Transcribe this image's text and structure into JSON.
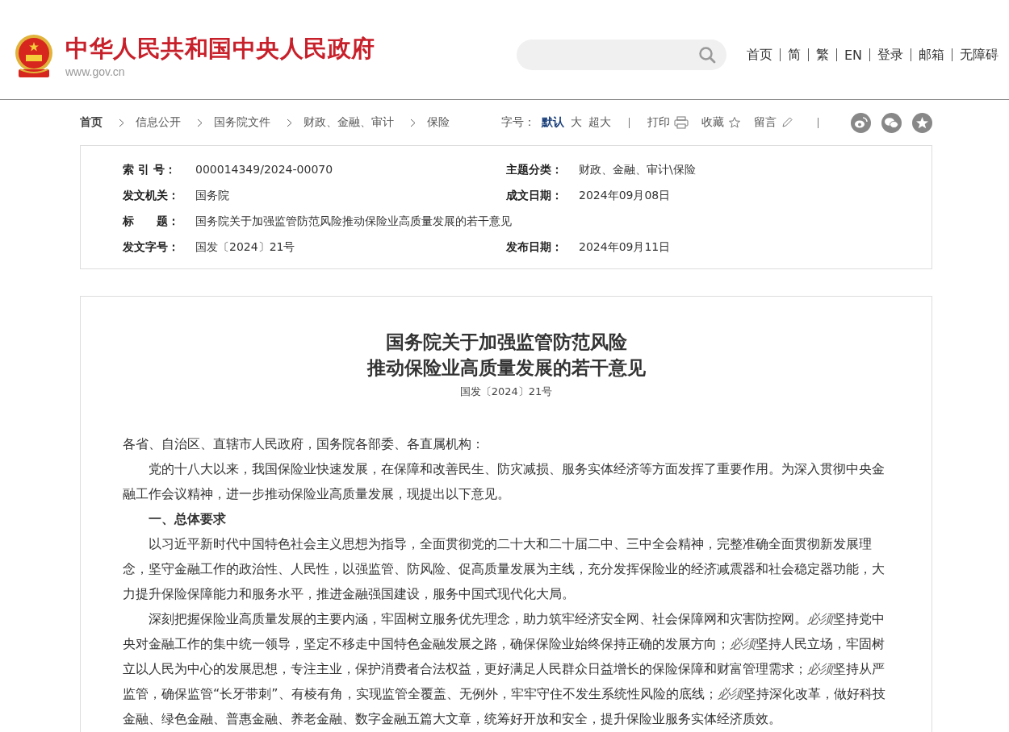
{
  "header": {
    "site_name": "中华人民共和国中央人民政府",
    "site_url": "www.gov.cn",
    "nav": [
      "首页",
      "简",
      "繁",
      "EN",
      "登录",
      "邮箱",
      "无障碍"
    ]
  },
  "breadcrumb": [
    "首页",
    "信息公开",
    "国务院文件",
    "财政、金融、审计",
    "保险"
  ],
  "toolbar": {
    "font_label": "字号：",
    "font_options": [
      {
        "label": "默认",
        "selected": true
      },
      {
        "label": "大",
        "selected": false
      },
      {
        "label": "超大",
        "selected": false
      }
    ],
    "actions": [
      {
        "label": "打印",
        "kind": "print"
      },
      {
        "label": "收藏",
        "kind": "favorite"
      },
      {
        "label": "留言",
        "kind": "comment"
      }
    ],
    "share": [
      {
        "kind": "weibo"
      },
      {
        "kind": "wechat"
      },
      {
        "kind": "star"
      }
    ]
  },
  "info": [
    [
      {
        "label": "索 引 号：",
        "value": "000014349/2024-00070"
      },
      {
        "label": "主题分类：",
        "value": "财政、金融、审计\\保险"
      }
    ],
    [
      {
        "label": "发文机关：",
        "value": "国务院"
      },
      {
        "label": "成文日期：",
        "value": "2024年09月08日"
      }
    ],
    [
      {
        "label": "标　　题：",
        "value": "国务院关于加强监管防范风险推动保险业高质量发展的若干意见"
      }
    ],
    [
      {
        "label": "发文字号：",
        "value": "国发〔2024〕21号"
      },
      {
        "label": "发布日期：",
        "value": "2024年09月11日"
      }
    ]
  ],
  "article": {
    "title_lines": [
      "国务院关于加强监管防范风险",
      "推动保险业高质量发展的若干意见"
    ],
    "doc_number": "国发〔2024〕21号",
    "paragraphs": [
      {
        "kind": "salutation",
        "text": "各省、自治区、直辖市人民政府，国务院各部委、各直属机构："
      },
      {
        "kind": "body",
        "text": "党的十八大以来，我国保险业快速发展，在保障和改善民生、防灾减损、服务实体经济等方面发挥了重要作用。为深入贯彻中央金融工作会议精神，进一步推动保险业高质量发展，现提出以下意见。"
      },
      {
        "kind": "heading",
        "text": "一、总体要求"
      },
      {
        "kind": "body",
        "text": "以习近平新时代中国特色社会主义思想为指导，全面贯彻党的二十大和二十届二中、三中全会精神，完整准确全面贯彻新发展理念，坚守金融工作的政治性、人民性，以强监管、防风险、促高质量发展为主线，充分发挥保险业的经济减震器和社会稳定器功能，大力提升保险保障能力和服务水平，推进金融强国建设，服务中国式现代化大局。"
      },
      {
        "kind": "body",
        "runs": [
          {
            "text": "深刻把握保险业高质量发展的主要内涵，牢固树立服务优先理念，助力筑牢经济安全网、社会保障网和灾害防控网。",
            "italic": false
          },
          {
            "text": "必须",
            "italic": true
          },
          {
            "text": "坚持党中央对金融工作的集中统一领导，坚定不移走中国特色金融发展之路，确保保险业始终保持正确的发展方向；",
            "italic": false
          },
          {
            "text": "必须",
            "italic": true
          },
          {
            "text": "坚持人民立场，牢固树立以人民为中心的发展思想，专注主业，保护消费者合法权益，更好满足人民群众日益增长的保险保障和财富管理需求；",
            "italic": false
          },
          {
            "text": "必须",
            "italic": true
          },
          {
            "text": "坚持从严监管，确保监管“长牙带刺”、有棱有角，实现监管全覆盖、无例外，牢牢守住不发生系统性风险的底线；",
            "italic": false
          },
          {
            "text": "必须",
            "italic": true
          },
          {
            "text": "坚持深化改革，做好科技金融、绿色金融、普惠金融、养老金融、数字金融五篇大文章，统筹好开放和安全，提升保险业服务实体经济质效。",
            "italic": false
          }
        ]
      }
    ]
  }
}
